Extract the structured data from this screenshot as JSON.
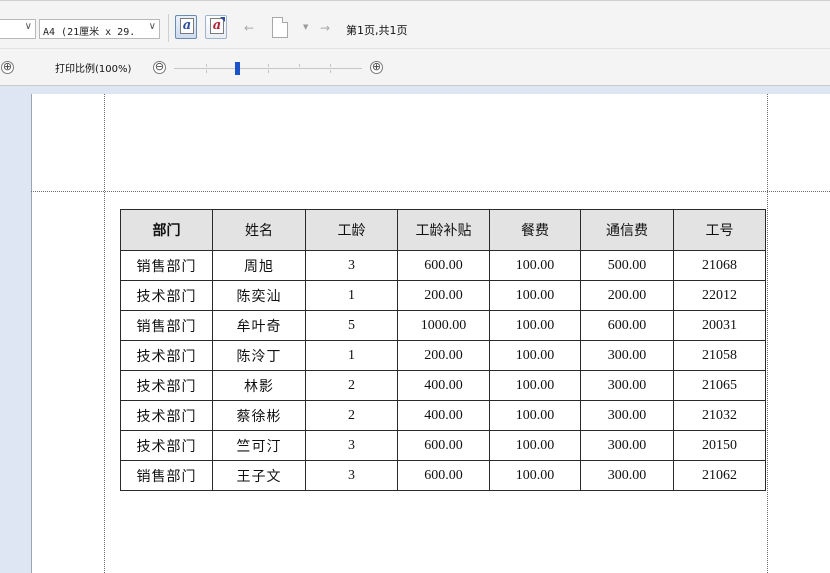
{
  "toolbar": {
    "paper_size": "A4 (21厘米 x 29.",
    "combo_arrow": "∨",
    "format_button_glyph": "a",
    "nav_prev": "←",
    "nav_next": "→",
    "dropdown_glyph": "▼",
    "page_status": "第1页,共1页"
  },
  "zoom": {
    "zoom_out": "⊖",
    "zoom_in": "⊕",
    "print_scale_label": "打印比例(100%)",
    "level_fraction": 0.34
  },
  "table": {
    "headers": [
      "部门",
      "姓名",
      "工龄",
      "工龄补贴",
      "餐费",
      "通信费",
      "工号"
    ],
    "rows": [
      [
        "销售部门",
        "周旭",
        "3",
        "600.00",
        "100.00",
        "500.00",
        "21068"
      ],
      [
        "技术部门",
        "陈奕汕",
        "1",
        "200.00",
        "100.00",
        "200.00",
        "22012"
      ],
      [
        "销售部门",
        "牟叶奇",
        "5",
        "1000.00",
        "100.00",
        "600.00",
        "20031"
      ],
      [
        "技术部门",
        "陈泠丁",
        "1",
        "200.00",
        "100.00",
        "300.00",
        "21058"
      ],
      [
        "技术部门",
        "林影",
        "2",
        "400.00",
        "100.00",
        "300.00",
        "21065"
      ],
      [
        "技术部门",
        "蔡徐彬",
        "2",
        "400.00",
        "100.00",
        "300.00",
        "21032"
      ],
      [
        "技术部门",
        "竺可汀",
        "3",
        "600.00",
        "100.00",
        "300.00",
        "20150"
      ],
      [
        "销售部门",
        "王子文",
        "3",
        "600.00",
        "100.00",
        "300.00",
        "21062"
      ]
    ]
  }
}
